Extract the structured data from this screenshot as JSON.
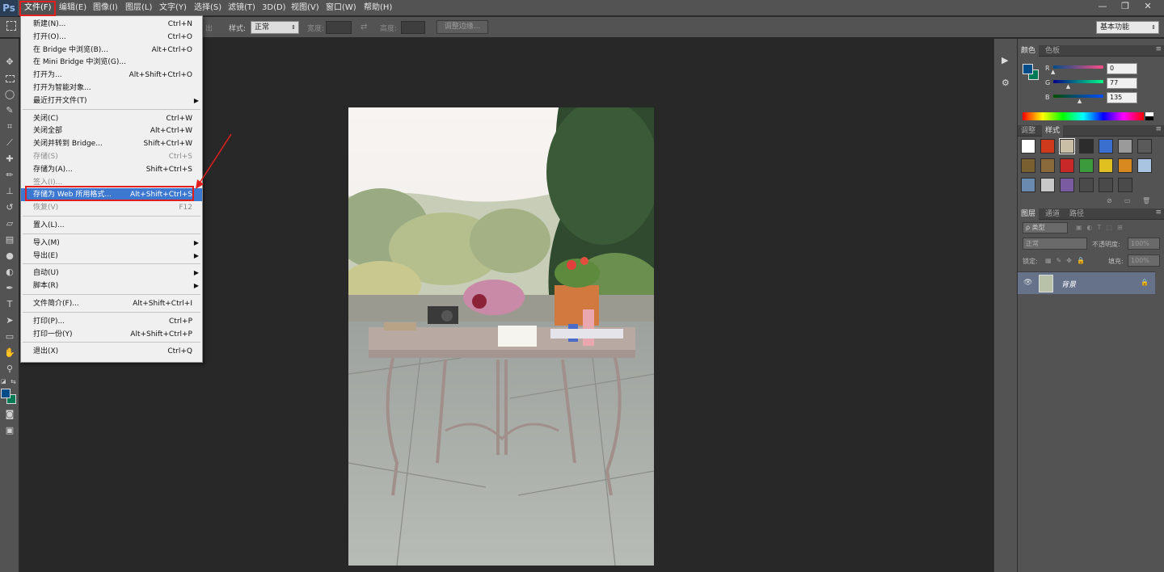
{
  "app": {
    "logo": "Ps"
  },
  "menubar": {
    "items": [
      "文件(F)",
      "编辑(E)",
      "图像(I)",
      "图层(L)",
      "文字(Y)",
      "选择(S)",
      "滤镜(T)",
      "3D(D)",
      "视图(V)",
      "窗口(W)",
      "帮助(H)"
    ],
    "active_index": 0,
    "window_controls": [
      "—",
      "❐",
      "✕"
    ]
  },
  "options_bar": {
    "partial_label": "出",
    "style_label": "样式:",
    "style_value": "正常",
    "width_label": "宽度:",
    "height_label": "高度:",
    "refine_edge_button": "调整边缘...",
    "workspace_value": "基本功能"
  },
  "file_menu": {
    "items": [
      {
        "label": "新建(N)...",
        "shortcut": "Ctrl+N"
      },
      {
        "label": "打开(O)...",
        "shortcut": "Ctrl+O"
      },
      {
        "label": "在 Bridge 中浏览(B)...",
        "shortcut": "Alt+Ctrl+O"
      },
      {
        "label": "在 Mini Bridge 中浏览(G)...",
        "shortcut": ""
      },
      {
        "label": "打开为...",
        "shortcut": "Alt+Shift+Ctrl+O"
      },
      {
        "label": "打开为智能对象...",
        "shortcut": ""
      },
      {
        "label": "最近打开文件(T)",
        "shortcut": "",
        "submenu": true
      },
      {
        "separator": true
      },
      {
        "label": "关闭(C)",
        "shortcut": "Ctrl+W"
      },
      {
        "label": "关闭全部",
        "shortcut": "Alt+Ctrl+W"
      },
      {
        "label": "关闭并转到 Bridge...",
        "shortcut": "Shift+Ctrl+W"
      },
      {
        "label": "存储(S)",
        "shortcut": "Ctrl+S",
        "disabled": true
      },
      {
        "label": "存储为(A)...",
        "shortcut": "Shift+Ctrl+S"
      },
      {
        "label": "签入(I)...",
        "shortcut": "",
        "disabled": true
      },
      {
        "label": "存储为 Web 所用格式...",
        "shortcut": "Alt+Shift+Ctrl+S",
        "highlighted": true
      },
      {
        "label": "恢复(V)",
        "shortcut": "F12",
        "disabled": true
      },
      {
        "separator": true
      },
      {
        "label": "置入(L)...",
        "shortcut": ""
      },
      {
        "separator": true
      },
      {
        "label": "导入(M)",
        "shortcut": "",
        "submenu": true
      },
      {
        "label": "导出(E)",
        "shortcut": "",
        "submenu": true
      },
      {
        "separator": true
      },
      {
        "label": "自动(U)",
        "shortcut": "",
        "submenu": true
      },
      {
        "label": "脚本(R)",
        "shortcut": "",
        "submenu": true
      },
      {
        "separator": true
      },
      {
        "label": "文件简介(F)...",
        "shortcut": "Alt+Shift+Ctrl+I"
      },
      {
        "separator": true
      },
      {
        "label": "打印(P)...",
        "shortcut": "Ctrl+P"
      },
      {
        "label": "打印一份(Y)",
        "shortcut": "Alt+Shift+Ctrl+P"
      },
      {
        "separator": true
      },
      {
        "label": "退出(X)",
        "shortcut": "Ctrl+Q"
      }
    ]
  },
  "color_panel": {
    "tabs": [
      "颜色",
      "色板"
    ],
    "r_label": "R",
    "g_label": "G",
    "b_label": "B",
    "r": 0,
    "g": 77,
    "b": 135,
    "foreground": "#004d87",
    "background": "#007a55"
  },
  "styles_panel": {
    "tabs": [
      "调整",
      "样式"
    ],
    "swatches": [
      "#ffffff",
      "#d03a1c",
      "#c8bfa6",
      "#2c2c2c",
      "#3a6ecf",
      "#9a9a9a",
      "#5a5a5a",
      "#7a6030",
      "#8a6a3a",
      "#c82828",
      "#3c9a3c",
      "#e0c020",
      "#d88a20",
      "#a8c4e0",
      "#6a8ab0",
      "#c8c8c8",
      "#7a5aa0",
      "#4a4a4a",
      "#4a4a4a",
      "#4a4a4a"
    ]
  },
  "layers_panel": {
    "tabs": [
      "图层",
      "通道",
      "路径"
    ],
    "filter_label": "ρ 类型",
    "blend_mode": "正常",
    "opacity_label": "不透明度:",
    "opacity_value": "100%",
    "lock_label": "锁定:",
    "fill_label": "填充:",
    "fill_value": "100%",
    "layer_name": "背景"
  }
}
